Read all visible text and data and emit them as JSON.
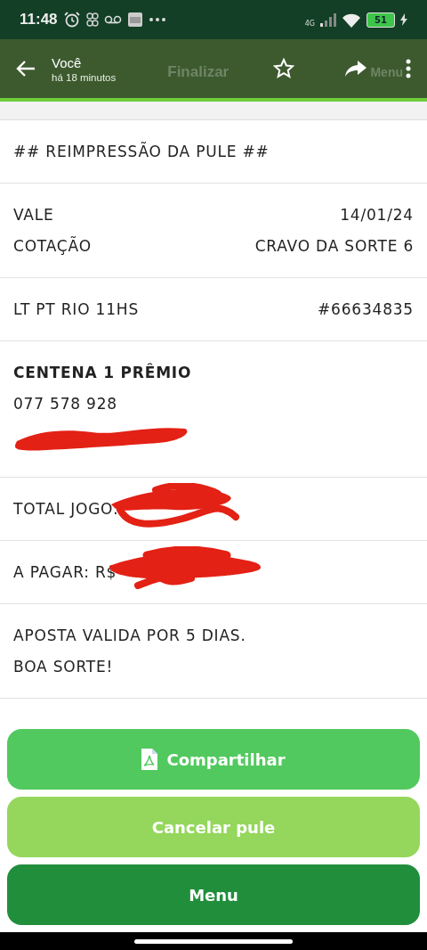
{
  "status_bar": {
    "time": "11:48",
    "network": "4G",
    "battery": "51"
  },
  "toolbar": {
    "title": "Você",
    "subtitle": "há 18 minutos",
    "ghost_texts": [
      "Finalizar",
      "Menu"
    ]
  },
  "receipt": {
    "sections": [
      {
        "lines": [
          {
            "kind": "text",
            "text": "## REIMPRESSÃO DA PULE ##"
          }
        ]
      },
      {
        "lines": [
          {
            "kind": "pair",
            "label": "VALE",
            "value": "14/01/24"
          },
          {
            "kind": "pair",
            "label": "COTAÇÃO",
            "value": "CRAVO DA SORTE 6"
          }
        ]
      },
      {
        "lines": [
          {
            "kind": "pair",
            "label": "LT PT RIO 11HS",
            "value": "#66634835"
          }
        ]
      },
      {
        "lines": [
          {
            "kind": "bold",
            "text": "CENTENA 1 PRÊMIO"
          },
          {
            "kind": "text",
            "text": "077  578  928"
          },
          {
            "kind": "redaction"
          }
        ]
      },
      {
        "lines": [
          {
            "kind": "text",
            "text": "TOTAL JOGO:",
            "redacted": true
          }
        ]
      },
      {
        "lines": [
          {
            "kind": "text",
            "text": "A PAGAR: R$",
            "redacted": true
          }
        ]
      },
      {
        "lines": [
          {
            "kind": "text",
            "text": "APOSTA VALIDA POR 5 DIAS."
          },
          {
            "kind": "text",
            "text": "BOA SORTE!"
          }
        ]
      }
    ]
  },
  "buttons": [
    {
      "kind": "icon",
      "label": "Compartilhar",
      "color": "#52c95f"
    },
    {
      "kind": "plain",
      "label": "Cancelar pule",
      "color": "#94d75c"
    },
    {
      "kind": "plain",
      "label": "Menu",
      "color": "#218e3c"
    }
  ]
}
